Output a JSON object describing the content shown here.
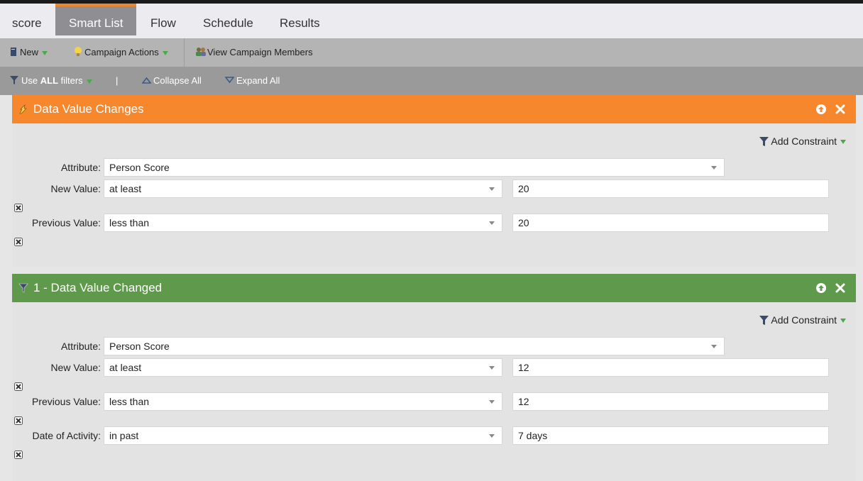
{
  "tabs": [
    "score",
    "Smart List",
    "Flow",
    "Schedule",
    "Results"
  ],
  "active_tab": "Smart List",
  "toolbar": {
    "new_label": "New",
    "campaign_actions_label": "Campaign Actions",
    "view_members_label": "View Campaign Members"
  },
  "filterbar": {
    "use_prefix": "Use ",
    "use_all": "ALL",
    "use_suffix": " filters",
    "divider": "|",
    "collapse_all": "Collapse All",
    "expand_all": "Expand All"
  },
  "colors": {
    "trigger_header": "#f7872d",
    "filter_header": "#5f9a4c",
    "tab_accent": "#f0862a"
  },
  "triggers": [
    {
      "title": "Data Value Changes",
      "add_constraint": "Add Constraint",
      "attribute_label": "Attribute:",
      "attribute_value": "Person Score",
      "rows": [
        {
          "label": "New Value:",
          "operator": "at least",
          "value": "20"
        },
        {
          "label": "Previous Value:",
          "operator": "less than",
          "value": "20"
        }
      ]
    }
  ],
  "filters": [
    {
      "title": "1 - Data Value Changed",
      "add_constraint": "Add Constraint",
      "attribute_label": "Attribute:",
      "attribute_value": "Person Score",
      "rows": [
        {
          "label": "New Value:",
          "operator": "at least",
          "value": "12"
        },
        {
          "label": "Previous Value:",
          "operator": "less than",
          "value": "12"
        },
        {
          "label": "Date of Activity:",
          "operator": "in past",
          "value": "7 days"
        }
      ]
    }
  ]
}
